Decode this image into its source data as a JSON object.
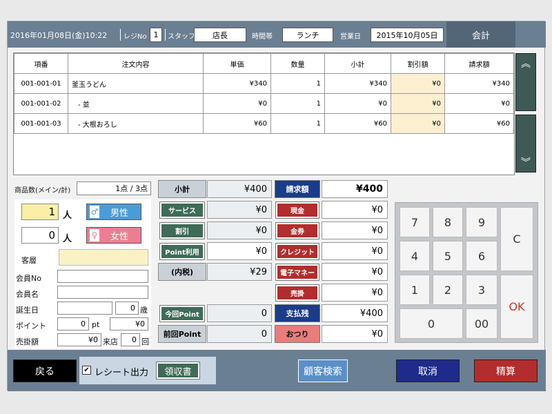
{
  "header": {
    "datetime": "2016年01月08日(金)10:22",
    "register_label": "レジNo",
    "register_no": "1",
    "staff_label": "スタッフ",
    "staff": "店長",
    "timeslot_label": "時間帯",
    "timeslot": "ランチ",
    "bizdate_label": "営業日",
    "bizdate": "2015年10月05日",
    "tab": "会計"
  },
  "grid": {
    "columns": [
      "項番",
      "注文内容",
      "単価",
      "数量",
      "小計",
      "割引額",
      "請求額"
    ],
    "rows": [
      [
        "001-001-01",
        "釜玉うどん",
        "¥340",
        "1",
        "¥340",
        "¥0",
        "¥340"
      ],
      [
        "001-001-02",
        "- 並",
        "¥0",
        "1",
        "¥0",
        "¥0",
        "¥0"
      ],
      [
        "001-001-03",
        "- 大根おろし",
        "¥60",
        "1",
        "¥60",
        "¥0",
        "¥60"
      ]
    ],
    "scroll_up": "︽",
    "scroll_down": "︾"
  },
  "info": {
    "count_label": "商品数(メイン/計)",
    "count_value": "1点 / 3点",
    "people_count": "1",
    "people_unit": "人",
    "people_count2": "0",
    "people_unit2": "人",
    "male": "男性",
    "female": "女性",
    "segment_label": "客層",
    "member_no_label": "会員No",
    "member_name_label": "会員名",
    "birthday_label": "誕生日",
    "age_value": "0",
    "age_unit": "歳",
    "point_label": "ポイント",
    "point_value": "0",
    "point_unit": "pt",
    "point_yen": "¥0",
    "sales_label": "売掛額",
    "sales_value": "¥0",
    "visit_label": "来店",
    "visit_value": "0",
    "visit_unit": "回"
  },
  "totals": {
    "subtotal_label": "小計",
    "subtotal": "¥400",
    "service_label": "サービス",
    "service": "¥0",
    "discount_label": "割引",
    "discount": "¥0",
    "pointuse_label": "Point利用",
    "pointuse": "¥0",
    "tax_label": "(内税)",
    "tax": "¥29",
    "thispoint_label": "今回Point",
    "thispoint": "0",
    "prevpoint_label": "前回Point",
    "prevpoint": "0",
    "billed_label": "請求額",
    "billed": "¥400",
    "cash_label": "現金",
    "cash": "¥0",
    "voucher_label": "金券",
    "voucher": "¥0",
    "credit_label": "クレジット",
    "credit": "¥0",
    "emoney_label": "電子マネー",
    "emoney": "¥0",
    "credit_sale_label": "売掛",
    "credit_sale": "¥0",
    "balance_label": "支払残",
    "balance": "¥400",
    "change_label": "おつり",
    "change": "¥0"
  },
  "keypad": {
    "k7": "7",
    "k8": "8",
    "k9": "9",
    "k4": "4",
    "k5": "5",
    "k6": "6",
    "k1": "1",
    "k2": "2",
    "k3": "3",
    "k0": "0",
    "k00": "00",
    "clear": "C",
    "ok": "OK"
  },
  "footer": {
    "back": "戻る",
    "receipt_label": "レシート出力",
    "receipt_check": "✔",
    "invoice": "領収書",
    "customer_search": "顧客検索",
    "cancel": "取消",
    "settle": "精算"
  }
}
